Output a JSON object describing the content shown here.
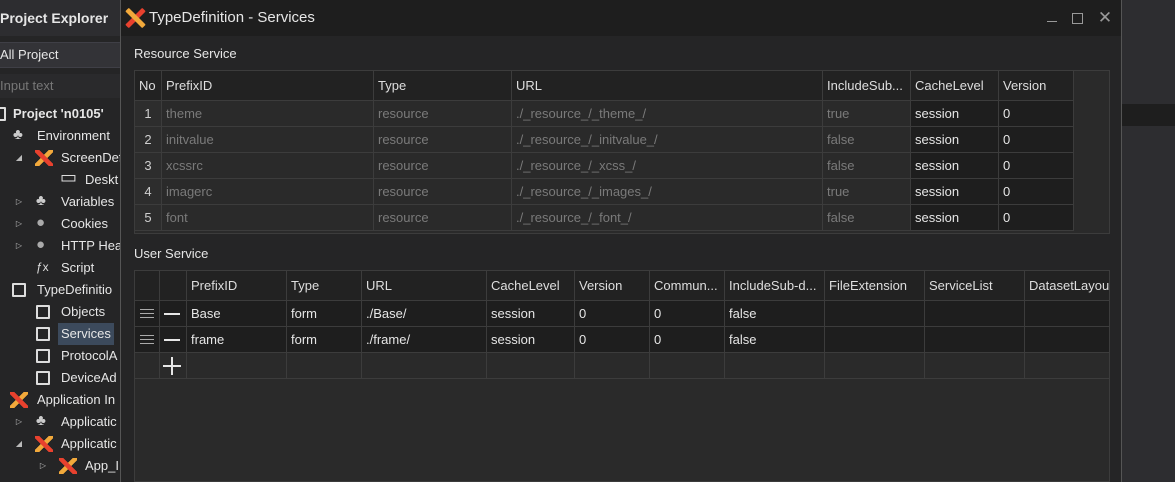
{
  "explorer": {
    "title": "Project Explorer",
    "combo": "All Project",
    "search_placeholder": "Input text",
    "tree": [
      {
        "label": "Project 'n0105'",
        "bold": true
      },
      {
        "label": "Environment"
      },
      {
        "label": "ScreenDef"
      },
      {
        "label": "Deskt"
      },
      {
        "label": "Variables"
      },
      {
        "label": "Cookies"
      },
      {
        "label": "HTTP Hea"
      },
      {
        "label": "Script"
      },
      {
        "label": "TypeDefinitio"
      },
      {
        "label": "Objects"
      },
      {
        "label": "Services",
        "selected": true
      },
      {
        "label": "ProtocolA"
      },
      {
        "label": "DeviceAd"
      },
      {
        "label": "Application In"
      },
      {
        "label": "Applicatic"
      },
      {
        "label": "Applicatic"
      },
      {
        "label": "App_I"
      }
    ]
  },
  "dialog": {
    "title": "TypeDefinition - Services",
    "resource_label": "Resource Service",
    "user_label": "User Service"
  },
  "resource": {
    "columns": [
      "No",
      "PrefixID",
      "Type",
      "URL",
      "IncludeSub...",
      "CacheLevel",
      "Version"
    ],
    "rows": [
      [
        "1",
        "theme",
        "resource",
        "./_resource_/_theme_/",
        "true",
        "session",
        "0"
      ],
      [
        "2",
        "initvalue",
        "resource",
        "./_resource_/_initvalue_/",
        "false",
        "session",
        "0"
      ],
      [
        "3",
        "xcssrc",
        "resource",
        "./_resource_/_xcss_/",
        "false",
        "session",
        "0"
      ],
      [
        "4",
        "imagerc",
        "resource",
        "./_resource_/_images_/",
        "true",
        "session",
        "0"
      ],
      [
        "5",
        "font",
        "resource",
        "./_resource_/_font_/",
        "false",
        "session",
        "0"
      ]
    ]
  },
  "user": {
    "columns": [
      "",
      "",
      "PrefixID",
      "Type",
      "URL",
      "CacheLevel",
      "Version",
      "Commun...",
      "IncludeSub-d...",
      "FileExtension",
      "ServiceList",
      "DatasetLayou"
    ],
    "rows": [
      [
        "Base",
        "form",
        "./Base/",
        "session",
        "0",
        "0",
        "false",
        "",
        "",
        ""
      ],
      [
        "frame",
        "form",
        "./frame/",
        "session",
        "0",
        "0",
        "false",
        "",
        "",
        ""
      ]
    ]
  }
}
